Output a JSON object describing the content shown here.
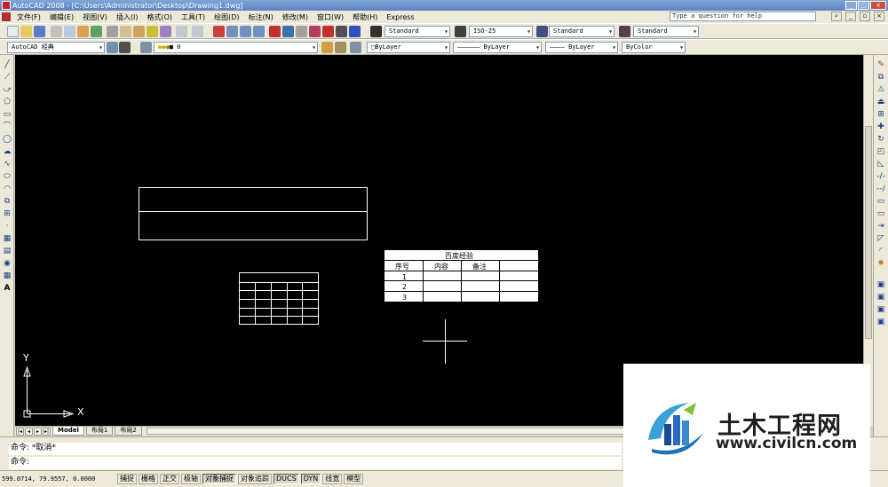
{
  "title_bar": {
    "title": "AutoCAD 2008 - [C:\\Users\\Administrator\\Desktop\\Drawing1.dwg]"
  },
  "menu": {
    "items": [
      "文件(F)",
      "编辑(E)",
      "视图(V)",
      "插入(I)",
      "格式(O)",
      "工具(T)",
      "绘图(D)",
      "标注(N)",
      "修改(M)",
      "窗口(W)",
      "帮助(H)",
      "Express"
    ],
    "help_placeholder": "Type a question for help"
  },
  "toolbar1": {
    "text_style": "Standard",
    "dim_style": "ISO-25",
    "table_style": "Standard",
    "multileader_style": "Standard"
  },
  "toolbar2": {
    "workspace": "AutoCAD 经典",
    "layer": "0",
    "color": "ByLayer",
    "linetype": "ByLayer",
    "lineweight": "ByLayer",
    "plot_style": "ByColor"
  },
  "canvas": {
    "ucs_x": "X",
    "ucs_y": "Y",
    "table": {
      "title": "百度经验",
      "headers": [
        "序号",
        "内容",
        "备注"
      ],
      "rows": [
        "1",
        "2",
        "3"
      ]
    }
  },
  "layout_tabs": [
    "Model",
    "布局1",
    "布局2"
  ],
  "command": {
    "line1": "命令: *取消*",
    "line2": "命令:"
  },
  "status": {
    "coords": "599.0714, 79.9557, 0.0000",
    "buttons": [
      "捕捉",
      "栅格",
      "正交",
      "极轴",
      "对象捕捉",
      "对象追踪",
      "DUCS",
      "DYN",
      "线宽",
      "模型"
    ]
  },
  "watermark": {
    "title": "土木工程网",
    "url": "www.civilcn.com"
  }
}
